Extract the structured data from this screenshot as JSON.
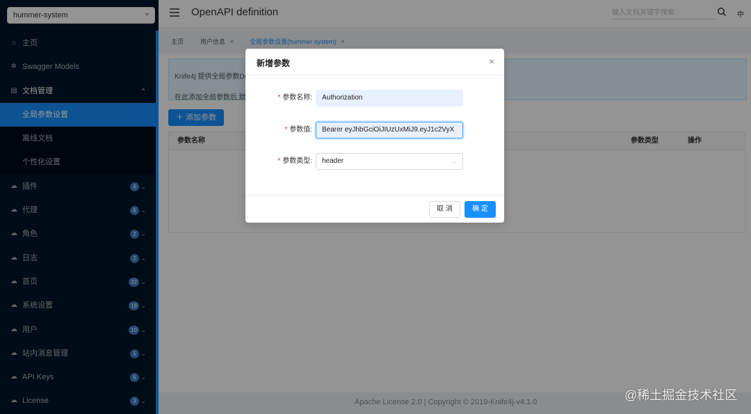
{
  "sidebar": {
    "project_select": "hummer-system",
    "items": [
      {
        "label": "主页",
        "icon": "home-icon"
      },
      {
        "label": "Swagger Models",
        "icon": "gear-icon"
      },
      {
        "label": "文档管理",
        "icon": "document-icon"
      },
      {
        "label": "全局参数设置"
      },
      {
        "label": "离线文档"
      },
      {
        "label": "个性化设置"
      },
      {
        "label": "插件",
        "icon": "cloud-icon",
        "badge": "6"
      },
      {
        "label": "代理",
        "icon": "cloud-icon",
        "badge": "6"
      },
      {
        "label": "角色",
        "icon": "cloud-icon",
        "badge": "2"
      },
      {
        "label": "日志",
        "icon": "cloud-icon",
        "badge": "2"
      },
      {
        "label": "首页",
        "icon": "cloud-icon",
        "badge": "32"
      },
      {
        "label": "系统设置",
        "icon": "cloud-icon",
        "badge": "18"
      },
      {
        "label": "用户",
        "icon": "cloud-icon",
        "badge": "10"
      },
      {
        "label": "站内消息管理",
        "icon": "cloud-icon",
        "badge": "5"
      },
      {
        "label": "API Keys",
        "icon": "cloud-icon",
        "badge": "6"
      },
      {
        "label": "License",
        "icon": "cloud-icon",
        "badge": "3"
      }
    ]
  },
  "header": {
    "title": "OpenAPI definition",
    "search_placeholder": "输入文档关键字搜索",
    "lang": "中"
  },
  "tabs": [
    {
      "label": "主页"
    },
    {
      "label": "用户信息",
      "close": "×"
    },
    {
      "label": "全局参数设置(hummer-system)",
      "close": "×"
    }
  ],
  "content": {
    "alert_line1": "Knife4j 提供全局参数De",
    "alert_line2": "在此添加全局参数后,默",
    "add_button": "添加参数",
    "add_button_icon": "plus-icon",
    "columns": [
      "参数名称",
      "参数类型",
      "操作"
    ]
  },
  "footer": {
    "text": "Apache License 2.0 | Copyright © 2019-Knife4j-v4.1.0",
    "watermark": "@稀土掘金技术社区"
  },
  "modal": {
    "title": "新增参数",
    "close": "×",
    "required_mark": "*",
    "fields": {
      "name_label": "参数名称:",
      "name_value": "Authorization",
      "value_label": "参数值:",
      "value_value": "Bearer eyJhbGciOiJIUzUxMiJ9.eyJ1c2VyX",
      "type_label": "参数类型:",
      "type_value": "header"
    },
    "cancel": "取 消",
    "ok": "确 定"
  },
  "colors": {
    "primary": "#1890ff",
    "sidebar_bg": "#001529",
    "required": "#f5222d"
  }
}
